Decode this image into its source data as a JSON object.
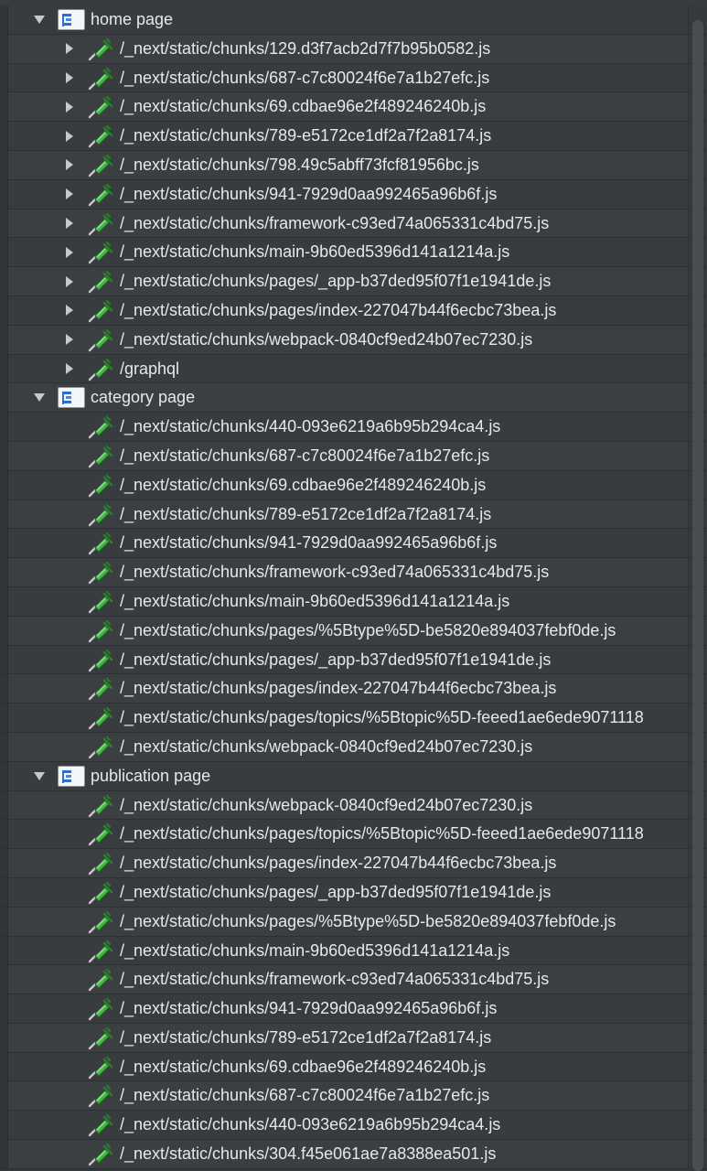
{
  "groups": [
    {
      "label": "home page",
      "expanded": true,
      "items": [
        {
          "label": "/_next/static/chunks/129.d3f7acb2d7f7b95b0582.js",
          "has_children": true
        },
        {
          "label": "/_next/static/chunks/687-c7c80024f6e7a1b27efc.js",
          "has_children": true
        },
        {
          "label": "/_next/static/chunks/69.cdbae96e2f489246240b.js",
          "has_children": true
        },
        {
          "label": "/_next/static/chunks/789-e5172ce1df2a7f2a8174.js",
          "has_children": true
        },
        {
          "label": "/_next/static/chunks/798.49c5abff73fcf81956bc.js",
          "has_children": true
        },
        {
          "label": "/_next/static/chunks/941-7929d0aa992465a96b6f.js",
          "has_children": true
        },
        {
          "label": "/_next/static/chunks/framework-c93ed74a065331c4bd75.js",
          "has_children": true
        },
        {
          "label": "/_next/static/chunks/main-9b60ed5396d141a1214a.js",
          "has_children": true
        },
        {
          "label": "/_next/static/chunks/pages/_app-b37ded95f07f1e1941de.js",
          "has_children": true
        },
        {
          "label": "/_next/static/chunks/pages/index-227047b44f6ecbc73bea.js",
          "has_children": true
        },
        {
          "label": "/_next/static/chunks/webpack-0840cf9ed24b07ec7230.js",
          "has_children": true
        },
        {
          "label": "/graphql",
          "has_children": true
        }
      ]
    },
    {
      "label": "category page",
      "expanded": true,
      "items": [
        {
          "label": "/_next/static/chunks/440-093e6219a6b95b294ca4.js",
          "has_children": false
        },
        {
          "label": "/_next/static/chunks/687-c7c80024f6e7a1b27efc.js",
          "has_children": false
        },
        {
          "label": "/_next/static/chunks/69.cdbae96e2f489246240b.js",
          "has_children": false
        },
        {
          "label": "/_next/static/chunks/789-e5172ce1df2a7f2a8174.js",
          "has_children": false
        },
        {
          "label": "/_next/static/chunks/941-7929d0aa992465a96b6f.js",
          "has_children": false
        },
        {
          "label": "/_next/static/chunks/framework-c93ed74a065331c4bd75.js",
          "has_children": false
        },
        {
          "label": "/_next/static/chunks/main-9b60ed5396d141a1214a.js",
          "has_children": false
        },
        {
          "label": "/_next/static/chunks/pages/%5Btype%5D-be5820e894037febf0de.js",
          "has_children": false
        },
        {
          "label": "/_next/static/chunks/pages/_app-b37ded95f07f1e1941de.js",
          "has_children": false
        },
        {
          "label": "/_next/static/chunks/pages/index-227047b44f6ecbc73bea.js",
          "has_children": false
        },
        {
          "label": "/_next/static/chunks/pages/topics/%5Btopic%5D-feeed1ae6ede9071118",
          "has_children": false
        },
        {
          "label": "/_next/static/chunks/webpack-0840cf9ed24b07ec7230.js",
          "has_children": false
        }
      ]
    },
    {
      "label": "publication page",
      "expanded": true,
      "items": [
        {
          "label": "/_next/static/chunks/webpack-0840cf9ed24b07ec7230.js",
          "has_children": false
        },
        {
          "label": "/_next/static/chunks/pages/topics/%5Btopic%5D-feeed1ae6ede9071118",
          "has_children": false
        },
        {
          "label": "/_next/static/chunks/pages/index-227047b44f6ecbc73bea.js",
          "has_children": false
        },
        {
          "label": "/_next/static/chunks/pages/_app-b37ded95f07f1e1941de.js",
          "has_children": false
        },
        {
          "label": "/_next/static/chunks/pages/%5Btype%5D-be5820e894037febf0de.js",
          "has_children": false
        },
        {
          "label": "/_next/static/chunks/main-9b60ed5396d141a1214a.js",
          "has_children": false
        },
        {
          "label": "/_next/static/chunks/framework-c93ed74a065331c4bd75.js",
          "has_children": false
        },
        {
          "label": "/_next/static/chunks/941-7929d0aa992465a96b6f.js",
          "has_children": false
        },
        {
          "label": "/_next/static/chunks/789-e5172ce1df2a7f2a8174.js",
          "has_children": false
        },
        {
          "label": "/_next/static/chunks/69.cdbae96e2f489246240b.js",
          "has_children": false
        },
        {
          "label": "/_next/static/chunks/687-c7c80024f6e7a1b27efc.js",
          "has_children": false
        },
        {
          "label": "/_next/static/chunks/440-093e6219a6b95b294ca4.js",
          "has_children": false
        },
        {
          "label": "/_next/static/chunks/304.f45e061ae7a8388ea501.js",
          "has_children": false
        }
      ]
    }
  ],
  "icons": {
    "group": "thread-group-icon",
    "item": "http-sampler-icon",
    "expanded": "triangle-down-icon",
    "collapsed": "triangle-right-icon"
  },
  "colors": {
    "background": "#34383b",
    "row": "#383c3f",
    "text": "#e6e9eb",
    "twisty": "#c5c9cc",
    "sampler_green": "#49b548",
    "sampler_tip": "#c8c8c8"
  }
}
